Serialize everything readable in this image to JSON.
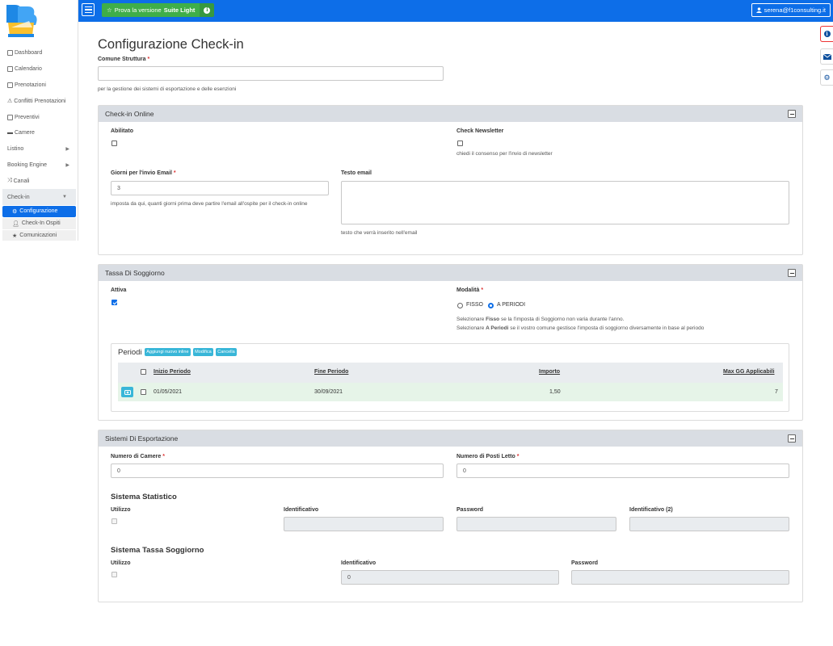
{
  "topbar": {
    "trial_prefix": "Prova la versione",
    "trial_bold": "Suite Light",
    "user": "serena@f1consulting.it"
  },
  "sidebar": {
    "items": [
      {
        "label": "Dashboard",
        "icon": "dashboard-icon"
      },
      {
        "label": "Calendario",
        "icon": "calendar-icon"
      },
      {
        "label": "Prenotazioni",
        "icon": "list-icon"
      },
      {
        "label": "Conflitti Prenotazioni",
        "icon": "warning-icon"
      },
      {
        "label": "Preventivi",
        "icon": "document-icon"
      },
      {
        "label": "Camere",
        "icon": "bed-icon"
      },
      {
        "label": "Listino"
      },
      {
        "label": "Booking Engine"
      },
      {
        "label": "Canali",
        "icon": "shuffle-icon"
      },
      {
        "label": "Check-in"
      }
    ],
    "sub_items": [
      {
        "label": "Configurazione",
        "icon": "gear-icon"
      },
      {
        "label": "Check-In Ospiti",
        "icon": "user-icon"
      },
      {
        "label": "Comunicazioni",
        "icon": "star-icon"
      }
    ]
  },
  "page": {
    "title": "Configurazione Check-in",
    "comune_label": "Comune Struttura",
    "comune_value": "",
    "comune_help": "per la gestione dei sistemi di esportazione e delle esenzioni"
  },
  "checkin_online": {
    "title": "Check-in Online",
    "abilitato_label": "Abilitato",
    "newsletter_label": "Check Newsletter",
    "newsletter_help": "chiedi il consenso per l'invio di newsletter",
    "giorni_label": "Giorni per l'invio Email",
    "giorni_value": "3",
    "giorni_help": "imposta da qui, quanti giorni prima deve partire l'email all'ospite per il check-in online",
    "testo_label": "Testo email",
    "testo_help": "testo che verrà inserito nell'email"
  },
  "tassa": {
    "title": "Tassa Di Soggiorno",
    "attiva_label": "Attiva",
    "modalita_label": "Modalità",
    "fisso_label": "FISSO",
    "periodi_label": "A PERIODI",
    "help_line1_pre": "Selezionare",
    "help_line1_bold": "Fisso",
    "help_line1_post": "se la l'imposta di Soggiorno non varia durante l'anno.",
    "help_line2_pre": "Selezionare",
    "help_line2_bold": "A Periodi",
    "help_line2_post": "se il vostro comune gestisce l'imposta di soggiorno diversamente in base al periodo",
    "periodi_title": "Periodi",
    "btn_add": "Aggiungi nuovo inline",
    "btn_edit": "Modifica",
    "btn_delete": "Cancella",
    "columns": [
      "Inizio Periodo",
      "Fine Periodo",
      "Importo",
      "Max GG Applicabili"
    ],
    "rows": [
      {
        "inizio": "01/05/2021",
        "fine": "30/09/2021",
        "importo": "1,50",
        "max": "7"
      }
    ]
  },
  "export": {
    "title": "Sistemi Di Esportazione",
    "camere_label": "Numero di Camere",
    "camere_value": "0",
    "posti_label": "Numero di Posti Letto",
    "posti_value": "0",
    "stat_title": "Sistema Statistico",
    "stat_utilizzo": "Utilizzo",
    "stat_ident": "Identificativo",
    "stat_password": "Password",
    "stat_ident2": "Identificativo (2)",
    "tassa_title": "Sistema Tassa Soggiorno",
    "tassa_utilizzo": "Utilizzo",
    "tassa_ident": "Identificativo",
    "tassa_ident_value": "0",
    "tassa_password": "Password"
  },
  "colors": {
    "primary": "#0d6ee8",
    "success": "#3fae49",
    "info": "#38b6d8",
    "panel_head": "#d9dde3"
  }
}
